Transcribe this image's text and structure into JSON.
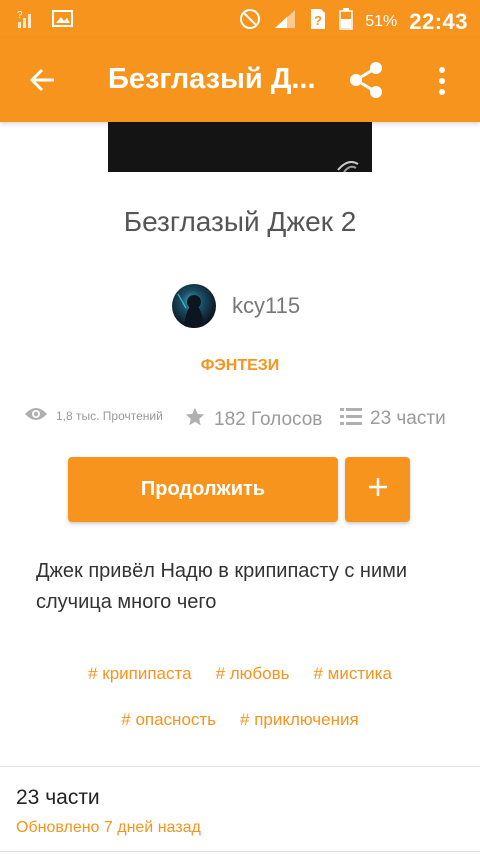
{
  "colors": {
    "accent": "#f7941d",
    "text_dark": "#333333",
    "text_muted": "#9a9a9a"
  },
  "status_bar": {
    "signal_label": "?",
    "battery_percent": "51%",
    "time": "22:43",
    "icons": [
      "signal-icon",
      "image-icon",
      "do-not-disturb-icon",
      "signal-strength-icon",
      "sim-unknown-icon",
      "battery-icon"
    ]
  },
  "toolbar": {
    "title": "Безглазый Д...",
    "back_icon": "arrow-left-icon",
    "share_icon": "share-icon",
    "more_icon": "more-vertical-icon"
  },
  "story": {
    "title": "Безглазый Джек 2",
    "author": "kcy115",
    "genre": "ФЭНТЕЗИ",
    "reads": "1,8 тыс. Прочтений",
    "votes": "182 Голосов",
    "parts": "23 части",
    "description": "Джек привёл Надю в крипипасту с ними случица много чего"
  },
  "actions": {
    "continue_label": "Продолжить",
    "add_label": "+"
  },
  "tags": {
    "row1": [
      "# крипипаста",
      "# любовь",
      "# мистика"
    ],
    "row2": [
      "# опасность",
      "# приключения"
    ]
  },
  "table_of_contents": {
    "parts_label": "23 части",
    "updated_label": "Обновлено 7 дней назад"
  }
}
